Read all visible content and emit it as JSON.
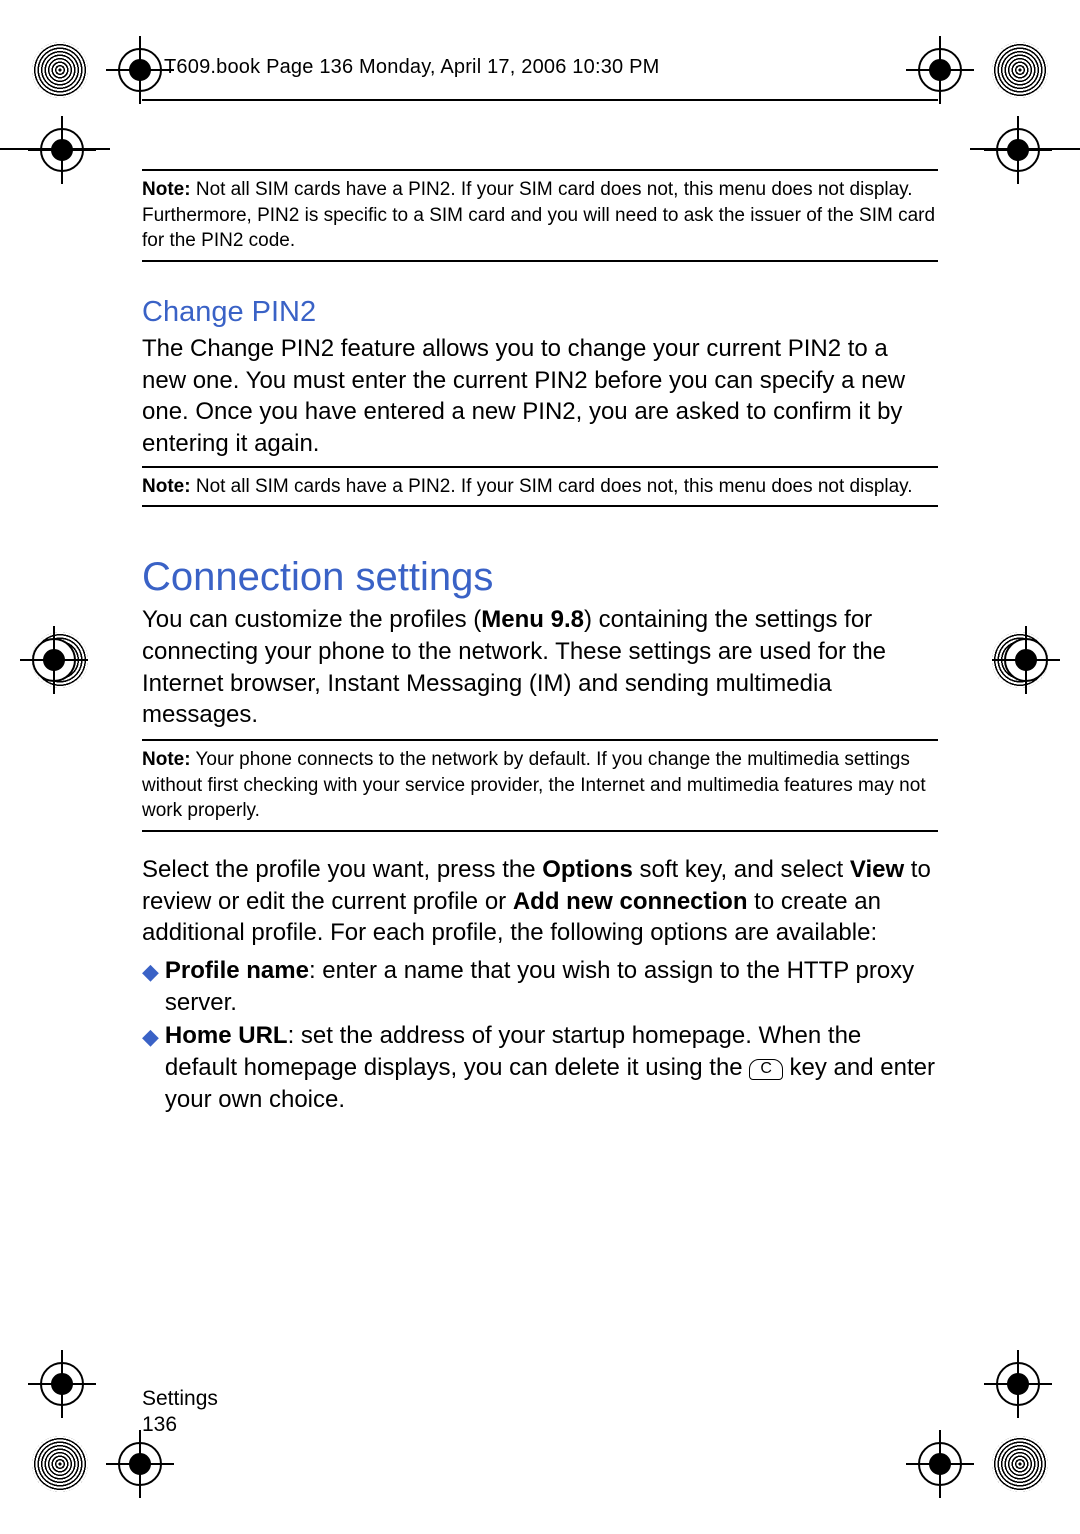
{
  "header": {
    "running_head": "T609.book  Page 136  Monday, April 17, 2006  10:30 PM"
  },
  "notes": {
    "label": "Note:",
    "n1": " Not all SIM cards have a PIN2. If your SIM card does not, this menu does not display. Furthermore, PIN2 is specific to a SIM card and you will need to ask the issuer of the SIM card for the PIN2 code.",
    "n2": " Not all SIM cards have a PIN2. If your SIM card does not, this menu does not display.",
    "n3": " Your phone connects to the network by default. If you change the multimedia settings without first checking with your service provider, the Internet and multimedia features may not work properly."
  },
  "sec1": {
    "title": "Change PIN2",
    "body": "The Change PIN2 feature allows you to change your current PIN2 to a new one. You must enter the current PIN2 before you can specify a new one. Once you have entered a new PIN2, you are asked to confirm it by entering it again."
  },
  "sec2": {
    "title": "Connection settings",
    "body_a": "You can customize the profiles (",
    "body_menu": "Menu 9.8",
    "body_b": ") containing the settings for connecting your phone to the network. These settings are used for the Internet browser, Instant Messaging (IM) and sending multimedia messages.",
    "para2_a": "Select the profile you want, press the ",
    "para2_opt": "Options",
    "para2_b": " soft key, and select ",
    "para2_view": "View",
    "para2_c": " to review or edit the current profile or ",
    "para2_add": "Add new connection",
    "para2_d": " to create an additional profile. For each profile, the following options are available:"
  },
  "list": {
    "item1_label": "Profile name",
    "item1_text": ": enter a name that you wish to assign to the HTTP proxy server.",
    "item2_label": "Home URL",
    "item2_text_a": ": set the address of your startup homepage. When the default homepage displays, you can delete it using the ",
    "item2_key": "C",
    "item2_text_b": " key and enter your own choice."
  },
  "footer": {
    "section": "Settings",
    "page": "136"
  }
}
